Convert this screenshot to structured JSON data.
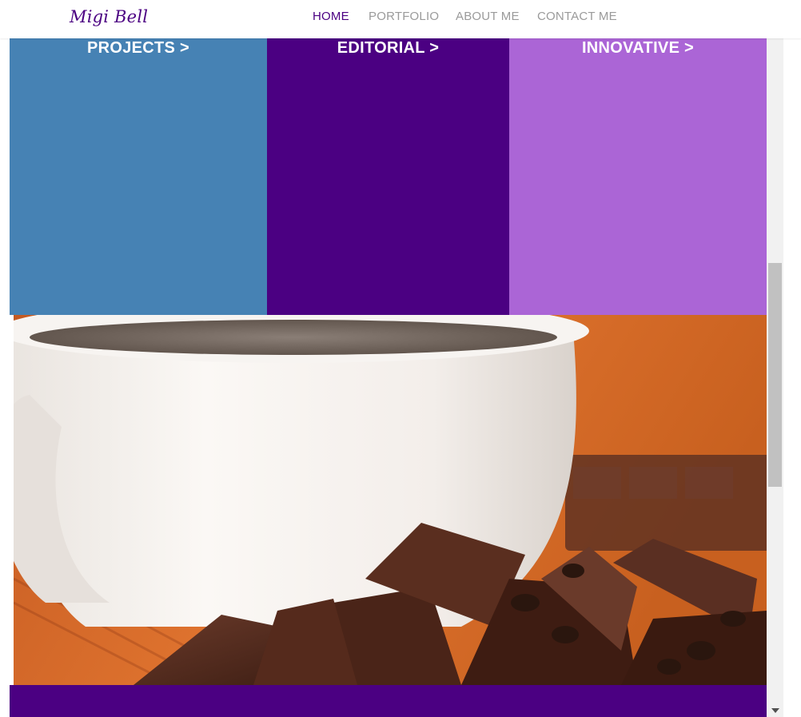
{
  "header": {
    "logo": "Migi Bell",
    "nav": [
      "HOME",
      "PORTFOLIO",
      "ABOUT ME",
      "CONTACT ME"
    ],
    "active_nav": "HOME"
  },
  "panels": [
    {
      "title": "PROJECTS >",
      "color": "#4682b4"
    },
    {
      "title": "EDITORIAL >",
      "color": "#4b0082"
    },
    {
      "title": "INNOVATIVE >",
      "color": "#ab65d6"
    }
  ],
  "hero_image": {
    "subject": "coffee-cup-with-chocolate-and-coffee-beans"
  },
  "footer": {
    "color": "#4b0082"
  },
  "colors": {
    "brand": "#4b0082",
    "nav_inactive": "#9a9a9a"
  }
}
